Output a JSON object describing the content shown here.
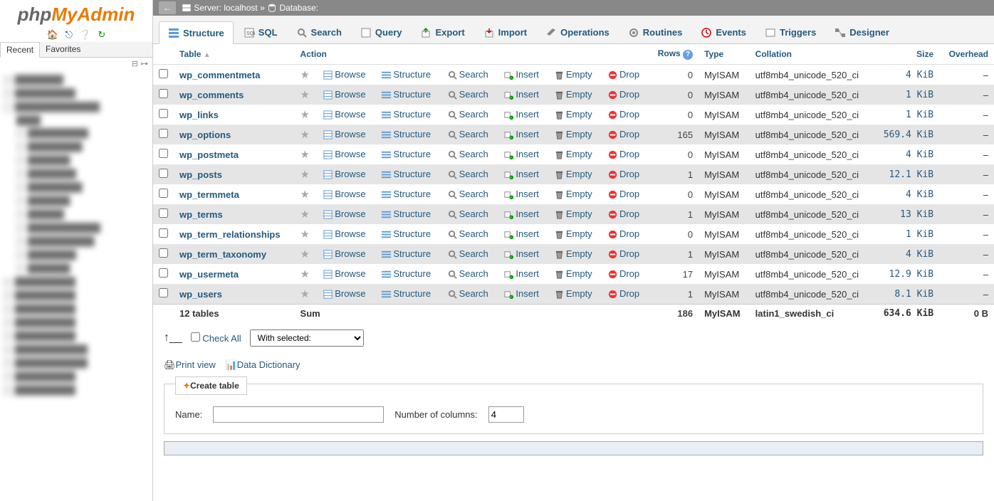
{
  "logo": {
    "part1": "php",
    "part2": "MyAdmin"
  },
  "navTabs": [
    "Recent",
    "Favorites"
  ],
  "breadcrumb": {
    "server_label": "Server:",
    "server": "localhost",
    "db_label": "Database:"
  },
  "tabs": [
    {
      "label": "Structure"
    },
    {
      "label": "SQL"
    },
    {
      "label": "Search"
    },
    {
      "label": "Query"
    },
    {
      "label": "Export"
    },
    {
      "label": "Import"
    },
    {
      "label": "Operations"
    },
    {
      "label": "Routines"
    },
    {
      "label": "Events"
    },
    {
      "label": "Triggers"
    },
    {
      "label": "Designer"
    }
  ],
  "headers": {
    "table": "Table",
    "action": "Action",
    "rows": "Rows",
    "type": "Type",
    "collation": "Collation",
    "size": "Size",
    "overhead": "Overhead"
  },
  "actions": {
    "browse": "Browse",
    "structure": "Structure",
    "search": "Search",
    "insert": "Insert",
    "empty": "Empty",
    "drop": "Drop"
  },
  "tables": [
    {
      "name": "wp_commentmeta",
      "rows": "0",
      "type": "MyISAM",
      "collation": "utf8mb4_unicode_520_ci",
      "size": "4 KiB",
      "oh": "–"
    },
    {
      "name": "wp_comments",
      "rows": "0",
      "type": "MyISAM",
      "collation": "utf8mb4_unicode_520_ci",
      "size": "1 KiB",
      "oh": "–"
    },
    {
      "name": "wp_links",
      "rows": "0",
      "type": "MyISAM",
      "collation": "utf8mb4_unicode_520_ci",
      "size": "1 KiB",
      "oh": "–"
    },
    {
      "name": "wp_options",
      "rows": "165",
      "type": "MyISAM",
      "collation": "utf8mb4_unicode_520_ci",
      "size": "569.4 KiB",
      "oh": "–"
    },
    {
      "name": "wp_postmeta",
      "rows": "0",
      "type": "MyISAM",
      "collation": "utf8mb4_unicode_520_ci",
      "size": "4 KiB",
      "oh": "–"
    },
    {
      "name": "wp_posts",
      "rows": "1",
      "type": "MyISAM",
      "collation": "utf8mb4_unicode_520_ci",
      "size": "12.1 KiB",
      "oh": "–"
    },
    {
      "name": "wp_termmeta",
      "rows": "0",
      "type": "MyISAM",
      "collation": "utf8mb4_unicode_520_ci",
      "size": "4 KiB",
      "oh": "–"
    },
    {
      "name": "wp_terms",
      "rows": "1",
      "type": "MyISAM",
      "collation": "utf8mb4_unicode_520_ci",
      "size": "13 KiB",
      "oh": "–"
    },
    {
      "name": "wp_term_relationships",
      "rows": "0",
      "type": "MyISAM",
      "collation": "utf8mb4_unicode_520_ci",
      "size": "1 KiB",
      "oh": "–"
    },
    {
      "name": "wp_term_taxonomy",
      "rows": "1",
      "type": "MyISAM",
      "collation": "utf8mb4_unicode_520_ci",
      "size": "4 KiB",
      "oh": "–"
    },
    {
      "name": "wp_usermeta",
      "rows": "17",
      "type": "MyISAM",
      "collation": "utf8mb4_unicode_520_ci",
      "size": "12.9 KiB",
      "oh": "–"
    },
    {
      "name": "wp_users",
      "rows": "1",
      "type": "MyISAM",
      "collation": "utf8mb4_unicode_520_ci",
      "size": "8.1 KiB",
      "oh": "–"
    }
  ],
  "sum": {
    "label": "12 tables",
    "sum": "Sum",
    "rows": "186",
    "type": "MyISAM",
    "collation": "latin1_swedish_ci",
    "size": "634.6 KiB",
    "oh": "0 B"
  },
  "checkAll": "Check All",
  "withSelected": "With selected:",
  "printView": "Print view",
  "dataDict": "Data Dictionary",
  "createTable": {
    "legend": "Create table",
    "name": "Name:",
    "cols": "Number of columns:",
    "colsVal": "4"
  }
}
